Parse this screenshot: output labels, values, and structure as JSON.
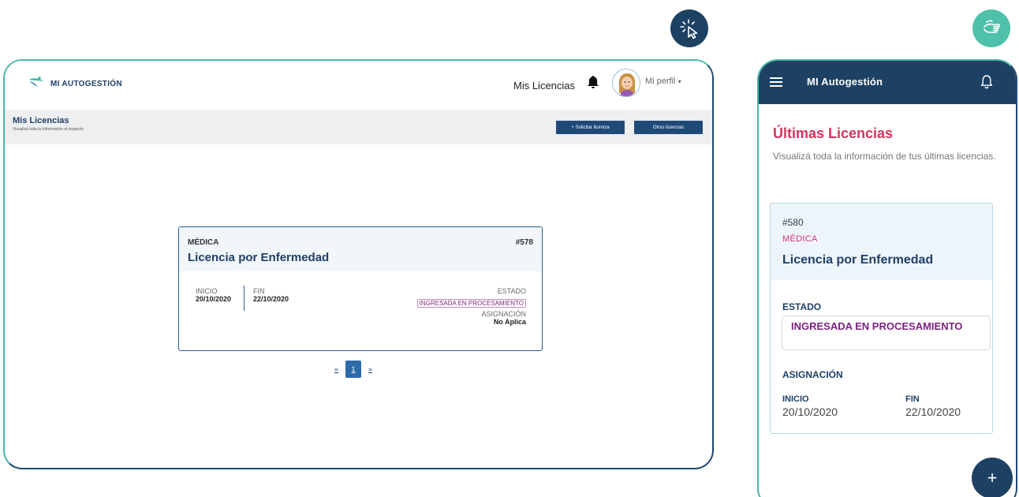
{
  "desktop": {
    "logo_text": "MI AUTOGESTIÓN",
    "nav_link": "Mis Licencias",
    "profile_label": "Mi perfil",
    "profile_caret": "▾",
    "subheader": {
      "title": "Mis Licencias",
      "description": "Visualizá toda tu información al respecto",
      "solicitar_button": "+ Solicitar licencia",
      "otras_button": "Otras licencias"
    },
    "card": {
      "type": "MÉDICA",
      "number": "#578",
      "title": "Licencia por Enfermedad",
      "inicio_label": "INICIO",
      "inicio_value": "20/10/2020",
      "fin_label": "FIN",
      "fin_value": "22/10/2020",
      "estado_label": "ESTADO",
      "estado_value": "INGRESADA EN PROCESAMIENTO",
      "asignacion_label": "ASIGNACIÓN",
      "asignacion_value": "No Aplica"
    },
    "pager": {
      "prev": "«",
      "current": "1",
      "next": "»"
    }
  },
  "mobile": {
    "app_title": "MI Autogestión",
    "title": "Últimas Licencias",
    "description": "Visualizá toda la información de tus últimas licencias.",
    "card": {
      "number": "#580",
      "type": "MÉDICA",
      "title": "Licencia por Enfermedad",
      "estado_label": "ESTADO",
      "estado_value": "INGRESADA EN PROCESAMIENTO",
      "asignacion_label": "ASIGNACIÓN",
      "inicio_label": "INICIO",
      "inicio_value": "20/10/2020",
      "fin_label": "FIN",
      "fin_value": "22/10/2020"
    },
    "fab_label": "+"
  },
  "icons": {
    "desktop_indicator": "cursor-click-icon",
    "mobile_indicator": "hand-touch-icon",
    "notifications": "bell-icon",
    "menu": "hamburger-menu-icon",
    "logo": "logo-icon"
  },
  "colors": {
    "navy": "#1d4163",
    "teal": "#4fc0aa",
    "primary_button": "#1f4a78",
    "pink_title": "#d6335a",
    "status_purple": "#7c2080"
  }
}
